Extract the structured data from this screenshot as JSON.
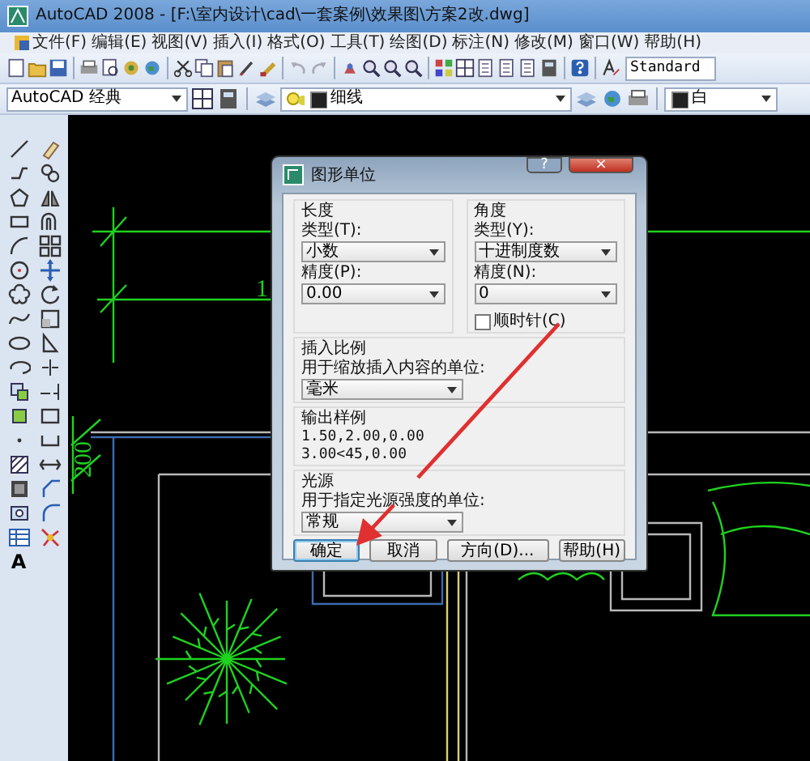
{
  "window": {
    "title": "AutoCAD 2008 - [F:\\室内设计\\cad\\一套案例\\效果图\\方案2改.dwg]"
  },
  "menu": [
    "文件(F)",
    "编辑(E)",
    "视图(V)",
    "插入(I)",
    "格式(O)",
    "工具(T)",
    "绘图(D)",
    "标注(N)",
    "修改(M)",
    "窗口(W)",
    "帮助(H)"
  ],
  "toolbar": {
    "text_style": "Standard"
  },
  "workspace_bar": {
    "workspace": "AutoCAD 经典",
    "layer": "细线",
    "color_name": "白"
  },
  "left_toolbar": {
    "text_tool": "A"
  },
  "canvas": {
    "dimension_texts": [
      "200",
      "1"
    ]
  },
  "dialog": {
    "title": "图形单位",
    "help_button": "?",
    "close_button": "×",
    "length": {
      "heading": "长度",
      "type_label": "类型(T):",
      "type_value": "小数",
      "precision_label": "精度(P):",
      "precision_value": "0.00"
    },
    "angle": {
      "heading": "角度",
      "type_label": "类型(Y):",
      "type_value": "十进制度数",
      "precision_label": "精度(N):",
      "precision_value": "0",
      "clockwise_label": "顺时针(C)",
      "clockwise_checked": false
    },
    "insert_scale": {
      "heading": "插入比例",
      "label": "用于缩放插入内容的单位:",
      "value": "毫米"
    },
    "sample_output": {
      "heading": "输出样例",
      "lines": [
        "1.50,2.00,0.00",
        "3.00<45,0.00"
      ]
    },
    "lighting": {
      "heading": "光源",
      "label": "用于指定光源强度的单位:",
      "value": "常规"
    },
    "buttons": [
      {
        "label": "确定",
        "selected": true
      },
      {
        "label": "取消",
        "selected": false
      },
      {
        "label": "方向(D)...",
        "selected": false
      },
      {
        "label": "帮助(H)",
        "selected": false
      }
    ]
  }
}
